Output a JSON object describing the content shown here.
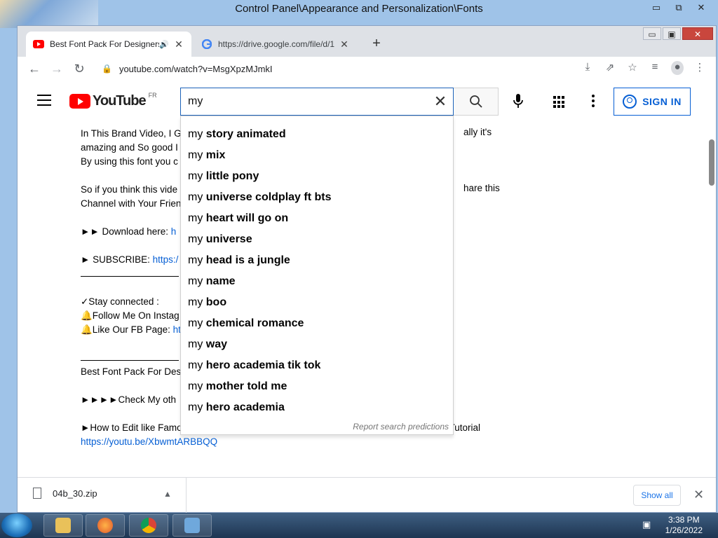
{
  "outer_window": {
    "title": "Control Panel\\Appearance and Personalization\\Fonts",
    "buttons": [
      "▭",
      "⧉",
      "✕"
    ]
  },
  "browser": {
    "tabs": [
      {
        "title": "Best Font Pack For Designers",
        "favicon": "youtube-icon",
        "active": true
      },
      {
        "title": "https://drive.google.com/file/d/1",
        "favicon": "google-icon",
        "active": false
      }
    ],
    "new_tab_label": "+",
    "window_buttons": [
      "▭",
      "▣",
      "✕"
    ],
    "nav": {
      "back": "←",
      "forward": "→",
      "reload": "↻"
    },
    "address": "youtube.com/watch?v=MsgXpzMJmkI"
  },
  "youtube": {
    "logo_text": "YouTube",
    "country_code": "FR",
    "search": {
      "value": "my ",
      "clear_label": "✕"
    },
    "signin_label": "SIGN IN",
    "suggestions": [
      {
        "prefix": "my",
        "bold": "story animated"
      },
      {
        "prefix": "my",
        "bold": "mix"
      },
      {
        "prefix": "my",
        "bold": "little pony"
      },
      {
        "prefix": "my",
        "bold": "universe coldplay ft bts"
      },
      {
        "prefix": "my",
        "bold": "heart will go on"
      },
      {
        "prefix": "my",
        "bold": "universe"
      },
      {
        "prefix": "my",
        "bold": "head is a jungle"
      },
      {
        "prefix": "my",
        "bold": "name"
      },
      {
        "prefix": "my",
        "bold": "boo"
      },
      {
        "prefix": "my",
        "bold": "chemical romance"
      },
      {
        "prefix": "my",
        "bold": "way"
      },
      {
        "prefix": "my",
        "bold": "hero academia tik tok"
      },
      {
        "prefix": "my",
        "bold": "mother told me"
      },
      {
        "prefix": "my",
        "bold": "hero academia"
      }
    ],
    "report_label": "Report search predictions",
    "description": {
      "l1": "In This Brand Video, I G",
      "l1_right": "ally it's",
      "l2": "amazing and So good I",
      "l3": "By using this font you c",
      "l4": "So if you think this vide",
      "l4_right": "hare this",
      "l5": "Channel with Your Frien",
      "l6a": "►► Download here:  ",
      "l6b": "h",
      "l7a": "► SUBSCRIBE:  ",
      "l7b": "https:/",
      "l8": "✓Stay connected :",
      "l9": "🔔Follow Me On Instag",
      "l10a": "🔔Like Our FB Page: ",
      "l10b": "ht",
      "l11": "Best Font Pack For Des",
      "l12": "►►►►Check My oth",
      "l13": "►How to Edit like Famous Instagram Photographer @MARKSINGERMAN | Photoshop Tutorial",
      "l14": "https://youtu.be/XbwmtARBBQQ"
    }
  },
  "download_bar": {
    "file_name": "04b_30.zip",
    "show_all_label": "Show all"
  },
  "taskbar": {
    "time": "3:38 PM",
    "date": "1/26/2022"
  }
}
